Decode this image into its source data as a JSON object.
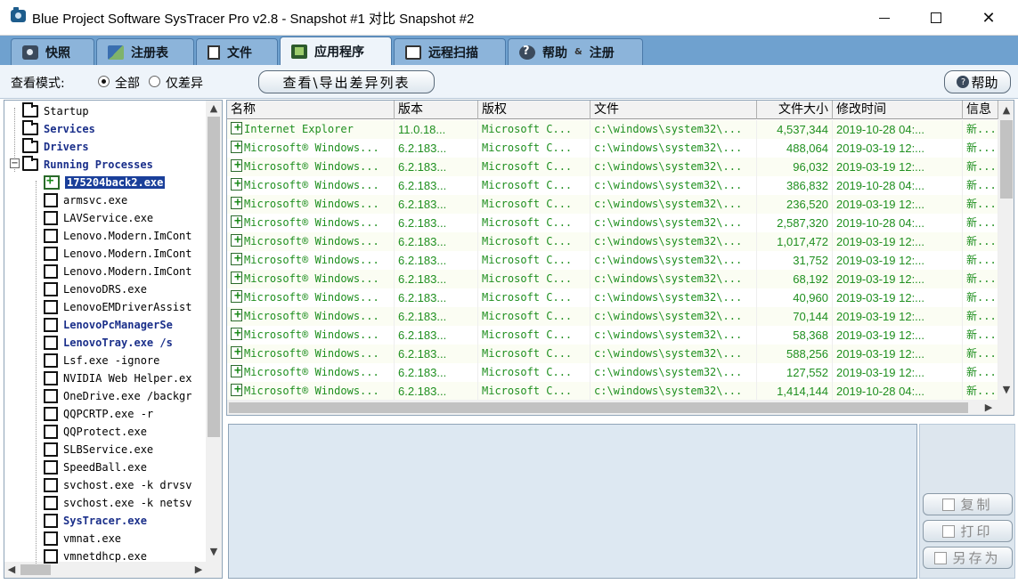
{
  "window": {
    "title": "Blue Project Software SysTracer Pro v2.8 - Snapshot #1 对比 Snapshot #2"
  },
  "tabs": [
    {
      "label": "快照",
      "icon": "camera-icon",
      "active": false
    },
    {
      "label": "注册表",
      "icon": "registry-icon",
      "active": false
    },
    {
      "label": "文件",
      "icon": "file-icon",
      "active": false
    },
    {
      "label": "应用程序",
      "icon": "application-icon",
      "active": true
    },
    {
      "label": "远程扫描",
      "icon": "remote-scan-icon",
      "active": false
    },
    {
      "label": "帮助",
      "label2": "注册",
      "separator": "&",
      "icon": "help-icon",
      "active": false
    }
  ],
  "toolbar": {
    "view_mode_label": "查看模式:",
    "radio_all": "全部",
    "radio_diff": "仅差异",
    "selected": "all",
    "export_button": "查看\\导出差异列表",
    "help_button": "帮助"
  },
  "tree": {
    "items": [
      {
        "label": "Startup",
        "kind": "folder",
        "style": "normal"
      },
      {
        "label": "Services",
        "kind": "folder",
        "style": "blue"
      },
      {
        "label": "Drivers",
        "kind": "folder",
        "style": "blue"
      },
      {
        "label": "Running Processes",
        "kind": "folder",
        "style": "blue",
        "expanded": true
      },
      {
        "label": "175204back2.exe",
        "kind": "new",
        "style": "selected"
      },
      {
        "label": "armsvc.exe",
        "kind": "doc",
        "style": "normal"
      },
      {
        "label": "LAVService.exe",
        "kind": "doc",
        "style": "normal"
      },
      {
        "label": "Lenovo.Modern.ImCont",
        "kind": "doc",
        "style": "normal"
      },
      {
        "label": "Lenovo.Modern.ImCont",
        "kind": "doc",
        "style": "normal"
      },
      {
        "label": "Lenovo.Modern.ImCont",
        "kind": "doc",
        "style": "normal"
      },
      {
        "label": "LenovoDRS.exe",
        "kind": "doc",
        "style": "normal"
      },
      {
        "label": "LenovoEMDriverAssist",
        "kind": "doc",
        "style": "normal"
      },
      {
        "label": "LenovoPcManagerSe",
        "kind": "doc",
        "style": "blue"
      },
      {
        "label": "LenovoTray.exe /s",
        "kind": "doc",
        "style": "blue"
      },
      {
        "label": "Lsf.exe -ignore",
        "kind": "doc",
        "style": "normal"
      },
      {
        "label": "NVIDIA Web Helper.ex",
        "kind": "doc",
        "style": "normal"
      },
      {
        "label": "OneDrive.exe /backgr",
        "kind": "doc",
        "style": "normal"
      },
      {
        "label": "QQPCRTP.exe -r",
        "kind": "doc",
        "style": "normal"
      },
      {
        "label": "QQProtect.exe",
        "kind": "doc",
        "style": "normal"
      },
      {
        "label": "SLBService.exe",
        "kind": "doc",
        "style": "normal"
      },
      {
        "label": "SpeedBall.exe",
        "kind": "doc",
        "style": "normal"
      },
      {
        "label": "svchost.exe -k drvsv",
        "kind": "doc",
        "style": "normal"
      },
      {
        "label": "svchost.exe -k netsv",
        "kind": "doc",
        "style": "normal"
      },
      {
        "label": "SysTracer.exe",
        "kind": "doc",
        "style": "blue"
      },
      {
        "label": "vmnat.exe",
        "kind": "doc",
        "style": "normal"
      },
      {
        "label": "vmnetdhcp.exe",
        "kind": "doc",
        "style": "normal"
      }
    ]
  },
  "table": {
    "columns": [
      "名称",
      "版本",
      "版权",
      "文件",
      "文件大小",
      "修改时间",
      "信息"
    ],
    "rows": [
      [
        "Internet Explorer",
        "11.0.18...",
        "Microsoft C...",
        "c:\\windows\\system32\\...",
        "4,537,344",
        "2019-10-28 04:...",
        "新..."
      ],
      [
        "Microsoft® Windows...",
        "6.2.183...",
        "Microsoft C...",
        "c:\\windows\\system32\\...",
        "488,064",
        "2019-03-19 12:...",
        "新..."
      ],
      [
        "Microsoft® Windows...",
        "6.2.183...",
        "Microsoft C...",
        "c:\\windows\\system32\\...",
        "96,032",
        "2019-03-19 12:...",
        "新..."
      ],
      [
        "Microsoft® Windows...",
        "6.2.183...",
        "Microsoft C...",
        "c:\\windows\\system32\\...",
        "386,832",
        "2019-10-28 04:...",
        "新..."
      ],
      [
        "Microsoft® Windows...",
        "6.2.183...",
        "Microsoft C...",
        "c:\\windows\\system32\\...",
        "236,520",
        "2019-03-19 12:...",
        "新..."
      ],
      [
        "Microsoft® Windows...",
        "6.2.183...",
        "Microsoft C...",
        "c:\\windows\\system32\\...",
        "2,587,320",
        "2019-10-28 04:...",
        "新..."
      ],
      [
        "Microsoft® Windows...",
        "6.2.183...",
        "Microsoft C...",
        "c:\\windows\\system32\\...",
        "1,017,472",
        "2019-03-19 12:...",
        "新..."
      ],
      [
        "Microsoft® Windows...",
        "6.2.183...",
        "Microsoft C...",
        "c:\\windows\\system32\\...",
        "31,752",
        "2019-03-19 12:...",
        "新..."
      ],
      [
        "Microsoft® Windows...",
        "6.2.183...",
        "Microsoft C...",
        "c:\\windows\\system32\\...",
        "68,192",
        "2019-03-19 12:...",
        "新..."
      ],
      [
        "Microsoft® Windows...",
        "6.2.183...",
        "Microsoft C...",
        "c:\\windows\\system32\\...",
        "40,960",
        "2019-03-19 12:...",
        "新..."
      ],
      [
        "Microsoft® Windows...",
        "6.2.183...",
        "Microsoft C...",
        "c:\\windows\\system32\\...",
        "70,144",
        "2019-03-19 12:...",
        "新..."
      ],
      [
        "Microsoft® Windows...",
        "6.2.183...",
        "Microsoft C...",
        "c:\\windows\\system32\\...",
        "58,368",
        "2019-03-19 12:...",
        "新..."
      ],
      [
        "Microsoft® Windows...",
        "6.2.183...",
        "Microsoft C...",
        "c:\\windows\\system32\\...",
        "588,256",
        "2019-03-19 12:...",
        "新..."
      ],
      [
        "Microsoft® Windows...",
        "6.2.183...",
        "Microsoft C...",
        "c:\\windows\\system32\\...",
        "127,552",
        "2019-03-19 12:...",
        "新..."
      ],
      [
        "Microsoft® Windows...",
        "6.2.183...",
        "Microsoft C...",
        "c:\\windows\\system32\\...",
        "1,414,144",
        "2019-10-28 04:...",
        "新..."
      ]
    ]
  },
  "actions": {
    "copy": "复制",
    "print": "打印",
    "save_as": "另存为"
  },
  "colors": {
    "tab_bar": "#6fa1cf",
    "new_item_text": "#1f8f1f",
    "tree_blue": "#1a2f8a",
    "selection": "#1a3f9a"
  }
}
